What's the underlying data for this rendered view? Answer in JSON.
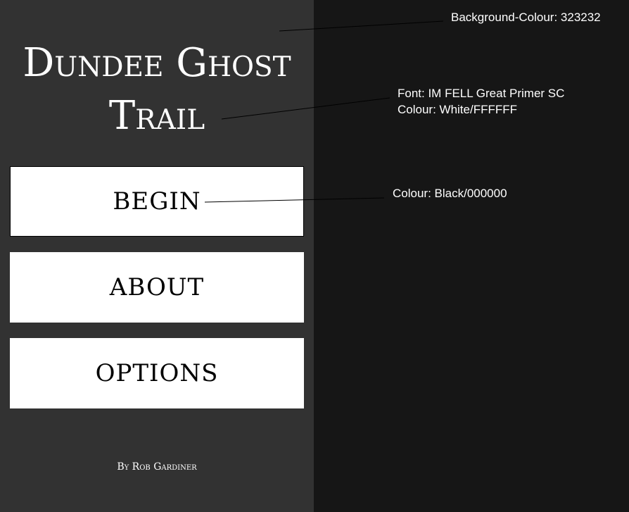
{
  "app": {
    "title": "Dundee Ghost Trail",
    "byline": "By Rob Gardiner",
    "panel_background": "#323232",
    "outer_background": "#161616"
  },
  "menu": {
    "begin_label": "BEGIN",
    "about_label": "ABOUT",
    "options_label": "OPTIONS"
  },
  "annotations": {
    "background": "Background-Colour: 323232",
    "font_line1": "Font: IM FELL Great Primer SC",
    "font_line2": "Colour: White/FFFFFF",
    "button_colour": "Colour: Black/000000"
  }
}
